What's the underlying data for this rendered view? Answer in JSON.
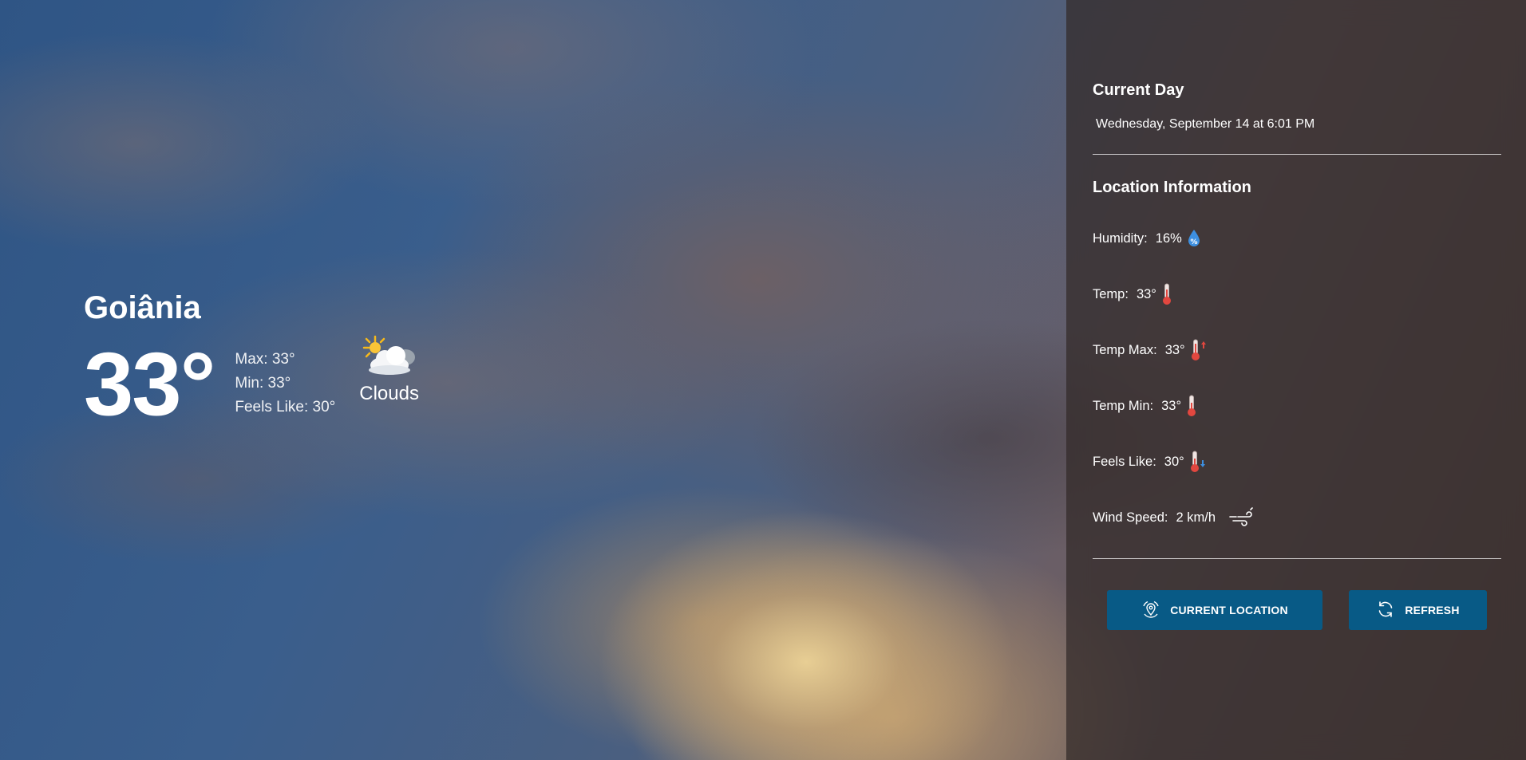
{
  "main": {
    "city": "Goiânia",
    "temperature": "33°",
    "max": "Max: 33°",
    "min": "Min: 33°",
    "feels_like": "Feels Like: 30°",
    "condition": "Clouds",
    "condition_icon": "partly-cloudy-icon"
  },
  "sidebar": {
    "current_day_title": "Current Day",
    "current_date": "Wednesday, September 14 at 6:01 PM",
    "location_title": "Location Information",
    "rows": [
      {
        "label": "Humidity:",
        "value": "16%",
        "icon": "humidity-icon"
      },
      {
        "label": "Temp:",
        "value": "33°",
        "icon": "thermometer-icon"
      },
      {
        "label": "Temp Max:",
        "value": "33°",
        "icon": "thermometer-up-icon"
      },
      {
        "label": "Temp Min:",
        "value": "33°",
        "icon": "thermometer-icon"
      },
      {
        "label": "Feels Like:",
        "value": "30°",
        "icon": "thermometer-down-icon"
      },
      {
        "label": "Wind Speed:",
        "value": "2 km/h",
        "icon": "wind-icon"
      }
    ],
    "buttons": {
      "current_location": "CURRENT LOCATION",
      "refresh": "REFRESH"
    }
  },
  "colors": {
    "button_bg": "#085a86",
    "thermometer_red": "#e2473f",
    "humidity_blue": "#3d8fe0"
  }
}
